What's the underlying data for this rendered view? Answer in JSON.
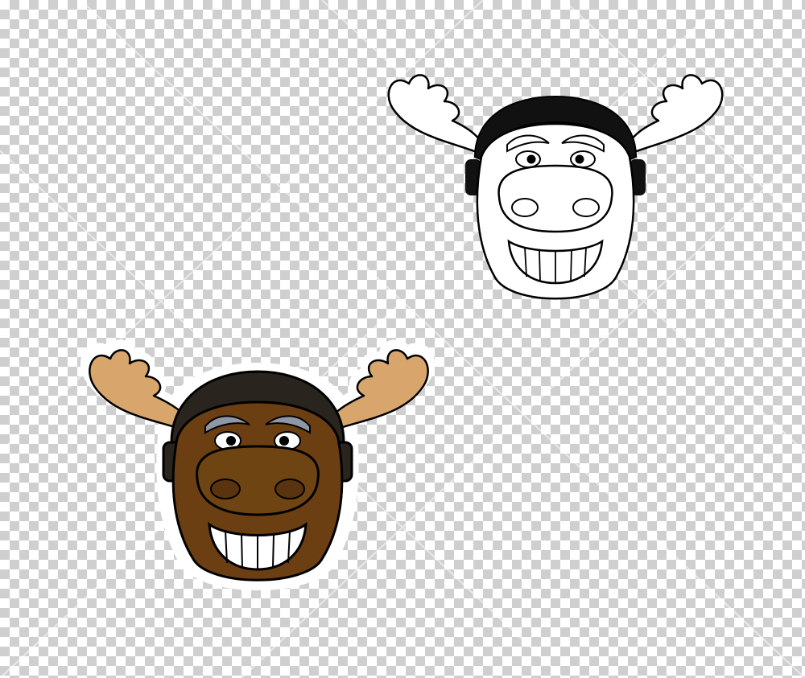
{
  "canvas": {
    "background": "transparency-checkerboard"
  },
  "mascots": [
    {
      "name": "moose-head-color",
      "colors": {
        "antler": "#d8a66c",
        "fur": "#6b3f12",
        "muzzle": "#6f4413",
        "helmet": "#2a241e",
        "brow": "#8f96a6",
        "outline": "#000000",
        "sticker_border": "#ffffff"
      }
    },
    {
      "name": "moose-head-outline",
      "colors": {
        "stroke": "#000000",
        "fill": "#ffffff"
      }
    }
  ]
}
